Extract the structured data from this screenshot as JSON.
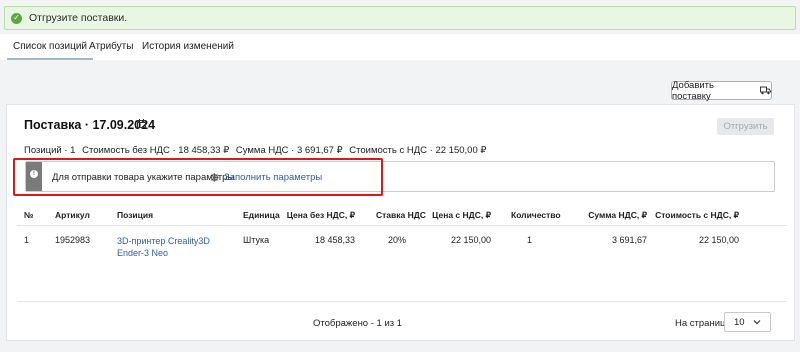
{
  "alert": {
    "text": "Отгрузите поставки."
  },
  "tabs": [
    {
      "label": "Список позиций",
      "active": true
    },
    {
      "label": "Атрибуты",
      "active": false
    },
    {
      "label": "История изменений",
      "active": false
    }
  ],
  "toolbar": {
    "add_label": "Добавить поставку",
    "add_icon": "truck-icon"
  },
  "card": {
    "title": "Поставка · 17.09.2024",
    "title_icon": "calendar-icon",
    "ship_label": "Отгрузить",
    "summary": {
      "positions": "Позиций · 1",
      "cost_no_vat": "Стоимость без НДС · 18 458,33 ₽",
      "vat_sum": "Сумма НДС · 3 691,67 ₽",
      "cost_with_vat": "Стоимость с НДС · 22 150,00 ₽"
    },
    "notice": {
      "message": "Для отправки товара укажите параметры",
      "link_label": "Заполнить параметры",
      "icon": "info-icon",
      "link_icon": "gear-icon",
      "highlight_color": "#e0161a"
    }
  },
  "table": {
    "headers": {
      "num": "№",
      "article": "Артикул",
      "position": "Позиция",
      "unit": "Единица",
      "price_no_vat": "Цена без НДС, ₽",
      "vat_rate": "Ставка НДС",
      "price_with_vat": "Цена с НДС, ₽",
      "quantity": "Количество",
      "vat_sum": "Сумма НДС, ₽",
      "cost_with_vat": "Стоимость с НДС, ₽"
    },
    "rows": [
      {
        "num": "1",
        "article": "1952983",
        "position": "3D-принтер Creality3D Ender-3 Neo",
        "unit": "Штука",
        "price_no_vat": "18 458,33",
        "vat_rate": "20%",
        "price_with_vat": "22 150,00",
        "quantity": "1",
        "vat_sum": "3 691,67",
        "cost_with_vat": "22 150,00"
      }
    ]
  },
  "pagination": {
    "shown": "Отображено - 1 из 1",
    "per_page_label": "На странице",
    "per_page_value": "10"
  },
  "colors": {
    "accent_link": "#2b61a8",
    "success": "#5aa93f",
    "highlight": "#e0161a"
  }
}
